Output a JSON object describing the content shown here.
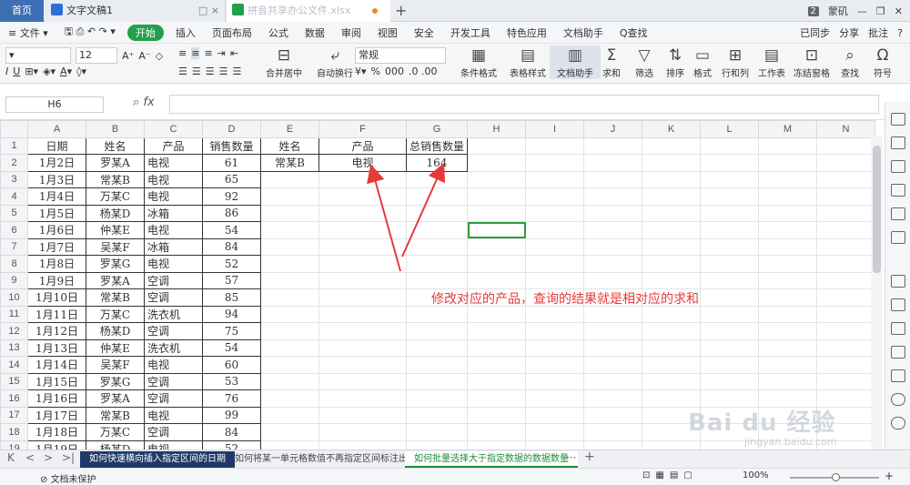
{
  "tabs": {
    "home": "首页",
    "doc": "文字文稿1",
    "xls": "拼音共享办公文件.xlsx",
    "badge": "2",
    "user": "蒙矶"
  },
  "menu": {
    "file": "文件",
    "items": [
      "开始",
      "插入",
      "页面布局",
      "公式",
      "数据",
      "审阅",
      "视图",
      "安全",
      "开发工具",
      "特色应用",
      "文档助手",
      "Q查找"
    ],
    "right": [
      "已同步",
      "分享",
      "批注",
      "?"
    ]
  },
  "ribbon": {
    "font_size": "12",
    "number_format": "常规",
    "big": [
      "合并居中",
      "自动换行",
      "条件格式",
      "表格样式",
      "文档助手",
      "求和",
      "筛选",
      "排序",
      "格式",
      "行和列",
      "工作表",
      "冻结窗格",
      "查找",
      "符号"
    ],
    "percent": "%",
    "thousand": "000",
    "inc_dec": ".0 .00"
  },
  "formula": {
    "namebox": "H6",
    "fx": "fx",
    "value": ""
  },
  "columns": [
    "A",
    "B",
    "C",
    "D",
    "E",
    "F",
    "G",
    "H",
    "I",
    "J",
    "K",
    "L",
    "M",
    "N"
  ],
  "rows": [
    "1",
    "2",
    "3",
    "4",
    "5",
    "6",
    "7",
    "8",
    "9",
    "10",
    "11",
    "12",
    "13",
    "14",
    "15",
    "16",
    "17",
    "18",
    "19"
  ],
  "header": [
    "日期",
    "姓名",
    "产品",
    "销售数量"
  ],
  "data": [
    [
      "1月2日",
      "罗某A",
      "电视",
      "61"
    ],
    [
      "1月3日",
      "常某B",
      "电视",
      "65"
    ],
    [
      "1月4日",
      "万某C",
      "电视",
      "92"
    ],
    [
      "1月5日",
      "杨某D",
      "冰箱",
      "86"
    ],
    [
      "1月6日",
      "仲某E",
      "电视",
      "54"
    ],
    [
      "1月7日",
      "吴某F",
      "冰箱",
      "84"
    ],
    [
      "1月8日",
      "罗某G",
      "电视",
      "52"
    ],
    [
      "1月9日",
      "罗某A",
      "空调",
      "57"
    ],
    [
      "1月10日",
      "常某B",
      "空调",
      "85"
    ],
    [
      "1月11日",
      "万某C",
      "洗衣机",
      "94"
    ],
    [
      "1月12日",
      "杨某D",
      "空调",
      "75"
    ],
    [
      "1月13日",
      "仲某E",
      "洗衣机",
      "54"
    ],
    [
      "1月14日",
      "吴某F",
      "电视",
      "60"
    ],
    [
      "1月15日",
      "罗某G",
      "空调",
      "53"
    ],
    [
      "1月16日",
      "罗某A",
      "空调",
      "76"
    ],
    [
      "1月17日",
      "常某B",
      "电视",
      "99"
    ],
    [
      "1月18日",
      "万某C",
      "空调",
      "84"
    ],
    [
      "1月19日",
      "杨某D",
      "电视",
      "52"
    ]
  ],
  "lookup": {
    "h_name": "姓名",
    "h_product": "产品",
    "h_total": "总销售数量",
    "name": "常某B",
    "product": "电视",
    "total": "164"
  },
  "annotation": "修改对应的产品，查询的结果就是相对应的求和",
  "sheets": [
    "如何快速横向插入指定区间的日期",
    "如何将某一单元格数值不再指定区间标注出来",
    "如何批量选择大于指定数据的数据数量"
  ],
  "status": {
    "protect": "文档未保护",
    "zoom": "100%"
  },
  "watermark": {
    "brand": "Bai du 经验",
    "url": "jingyan.baidu.com"
  },
  "colors": {
    "accent": "#22a04b",
    "annotation": "#e63a3a",
    "home_tab": "#3d6fb4"
  }
}
